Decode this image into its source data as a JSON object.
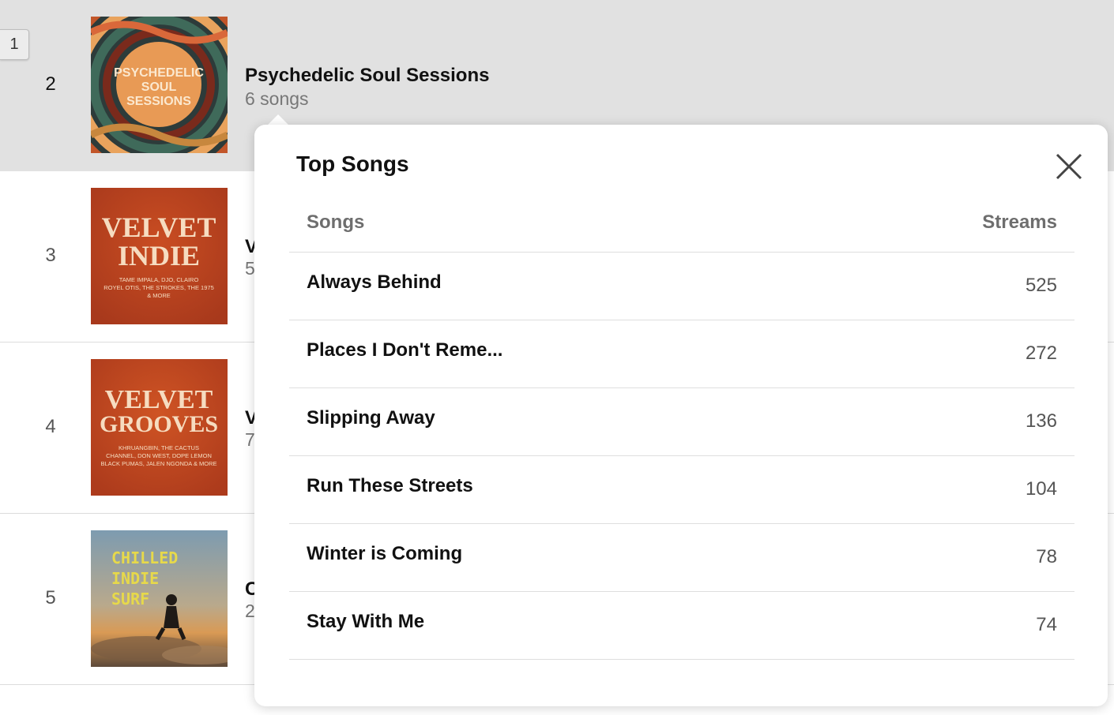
{
  "list_items": [
    {
      "rank": "1",
      "badge": true
    },
    {
      "rank": "2",
      "title": "Psychedelic Soul Sessions",
      "subtitle": "6 songs",
      "cover_text": [
        "PSYCHEDELIC",
        "SOUL",
        "SESSIONS"
      ]
    },
    {
      "rank": "3",
      "title": "V",
      "subtitle": "5",
      "cover_text": [
        "VELVET",
        "INDIE",
        "TAME IMPALA, DJO, CLAIRO",
        "ROYEL OTIS, THE STROKES, THE 1975",
        "& MORE"
      ]
    },
    {
      "rank": "4",
      "title": "V",
      "subtitle": "7",
      "cover_text": [
        "VELVET",
        "GROOVES",
        "KHRUANGBIN, THE CACTUS",
        "CHANNEL, DON WEST, DOPE LEMON",
        "BLACK PUMAS, JALEN NGONDA & MORE"
      ]
    },
    {
      "rank": "5",
      "title": "C",
      "subtitle": "2",
      "cover_text": [
        "CHILLED",
        "INDIE",
        "SURF"
      ]
    }
  ],
  "popover": {
    "title": "Top Songs",
    "columns": {
      "song": "Songs",
      "streams": "Streams"
    },
    "rows": [
      {
        "song": "Always Behind",
        "streams": "525"
      },
      {
        "song": "Places I Don't Reme...",
        "streams": "272"
      },
      {
        "song": "Slipping Away",
        "streams": "136"
      },
      {
        "song": "Run These Streets",
        "streams": "104"
      },
      {
        "song": "Winter is Coming",
        "streams": "78"
      },
      {
        "song": "Stay With Me",
        "streams": "74"
      }
    ],
    "close_icon": "close-icon"
  },
  "colors": {
    "active_row_bg": "#e1e1e1",
    "velvet_indie_cover": "#b8421f",
    "velvet_grooves_cover": "#c0441e",
    "psychedelic_center": "#e89a55",
    "surf_sky": "#6f8ea3"
  }
}
